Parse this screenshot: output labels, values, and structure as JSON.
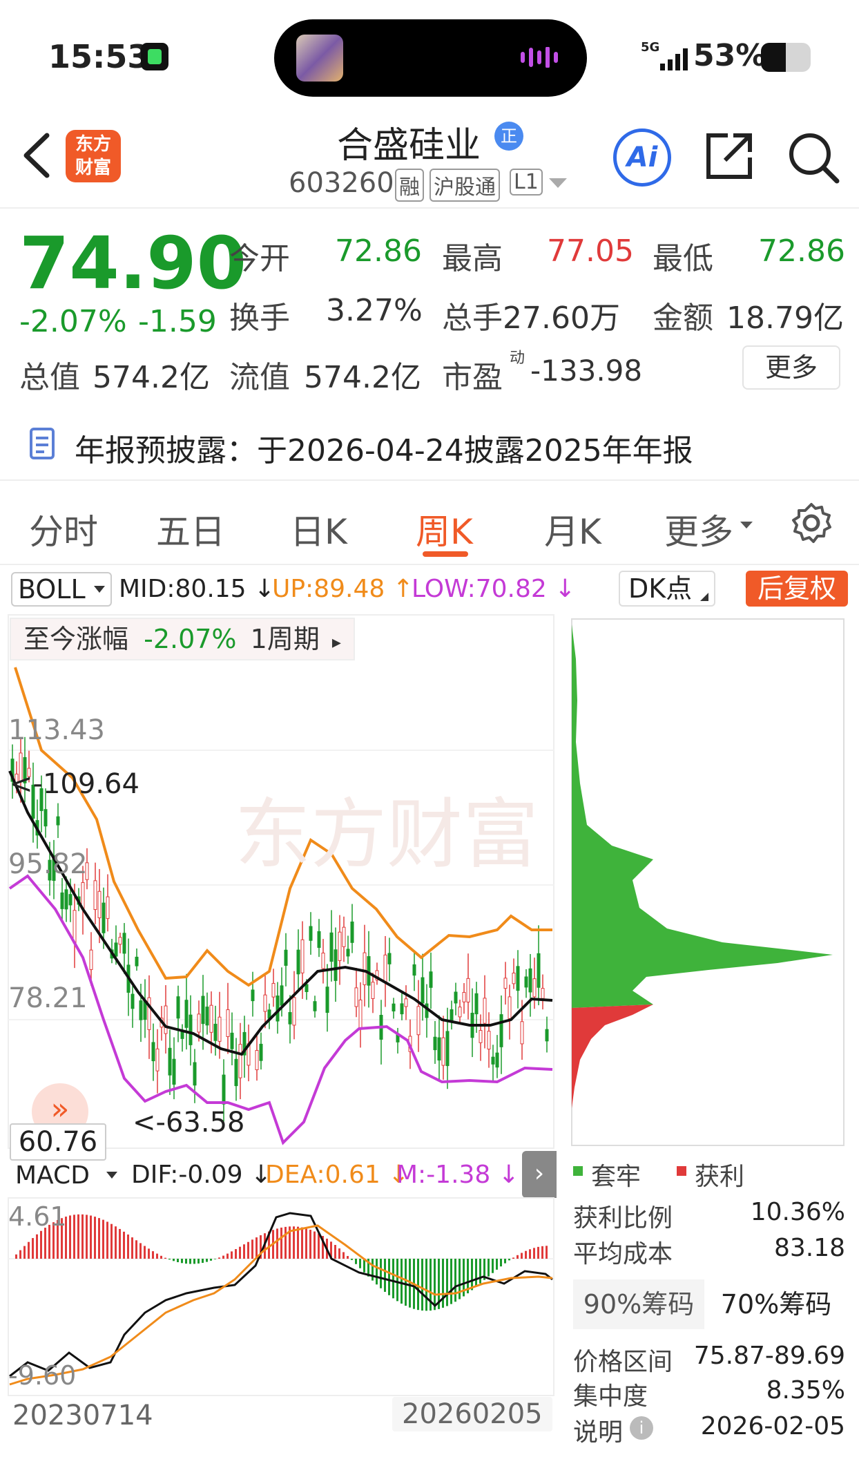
{
  "status_bar": {
    "time": "15:53",
    "network": "5G",
    "battery": "53%"
  },
  "header": {
    "logo_line1": "东方",
    "logo_line2": "财富",
    "stock_name": "合盛硅业",
    "badge": "正",
    "stock_code": "603260",
    "tag_margin": "融",
    "tag_connect": "沪股通",
    "tag_level": "L1",
    "ai_label": "Ai"
  },
  "quote": {
    "price": "74.90",
    "change_pct": "-2.07%",
    "change_abs": "-1.59",
    "open_label": "今开",
    "open": "72.86",
    "high_label": "最高",
    "high": "77.05",
    "low_label": "最低",
    "low": "72.86",
    "turnover_label": "换手",
    "turnover": "3.27%",
    "volume_label": "总手",
    "volume": "27.60万",
    "amount_label": "金额",
    "amount": "18.79亿",
    "mktcap_label": "总值",
    "mktcap": "574.2亿",
    "float_label": "流值",
    "float_cap": "574.2亿",
    "pe_label": "市盈",
    "pe_sup": "动",
    "pe": "-133.98",
    "more": "更多"
  },
  "notice": "年报预披露：于2026-04-24披露2025年年报",
  "tabs": [
    "分时",
    "五日",
    "日K",
    "周K",
    "月K",
    "更多"
  ],
  "active_tab": "周K",
  "indicator": {
    "name": "BOLL",
    "mid": "MID:80.15 ↓",
    "up": "UP:89.48 ↑",
    "low": "LOW:70.82 ↓",
    "dk": "DK点",
    "restore": "后复权"
  },
  "chart": {
    "period_label": "至今涨幅",
    "period_pct": "-2.07%",
    "period_len": "1周期",
    "y_labels": [
      "113.43",
      "95.82",
      "78.21"
    ],
    "high_marker": "<-109.64",
    "low_marker": "<-63.58",
    "current_price_tag": "60.76",
    "macd_name": "MACD",
    "dif": "DIF:-0.09 ↓",
    "dea": "DEA:0.61 ↓",
    "m": "M:-1.38 ↓",
    "macd_top": "4.61",
    "macd_bottom": "-9.60",
    "date_start": "20230714",
    "date_end": "20260205",
    "watermark": "东方财富"
  },
  "chips": {
    "legend_trapped": "套牢",
    "legend_profit": "获利",
    "profit_ratio_label": "获利比例",
    "profit_ratio": "10.36%",
    "avg_cost_label": "平均成本",
    "avg_cost": "83.18",
    "tab_90": "90%筹码",
    "tab_70": "70%筹码",
    "range_label": "价格区间",
    "range": "75.87-89.69",
    "concentration_label": "集中度",
    "concentration": "8.35%",
    "note_label": "说明",
    "note_date": "2026-02-05"
  },
  "colors": {
    "up": "#e03a3a",
    "down": "#1a9a2b",
    "accent": "#f05a28",
    "boll_up": "#f08b1a",
    "boll_low": "#c43ad6"
  }
}
